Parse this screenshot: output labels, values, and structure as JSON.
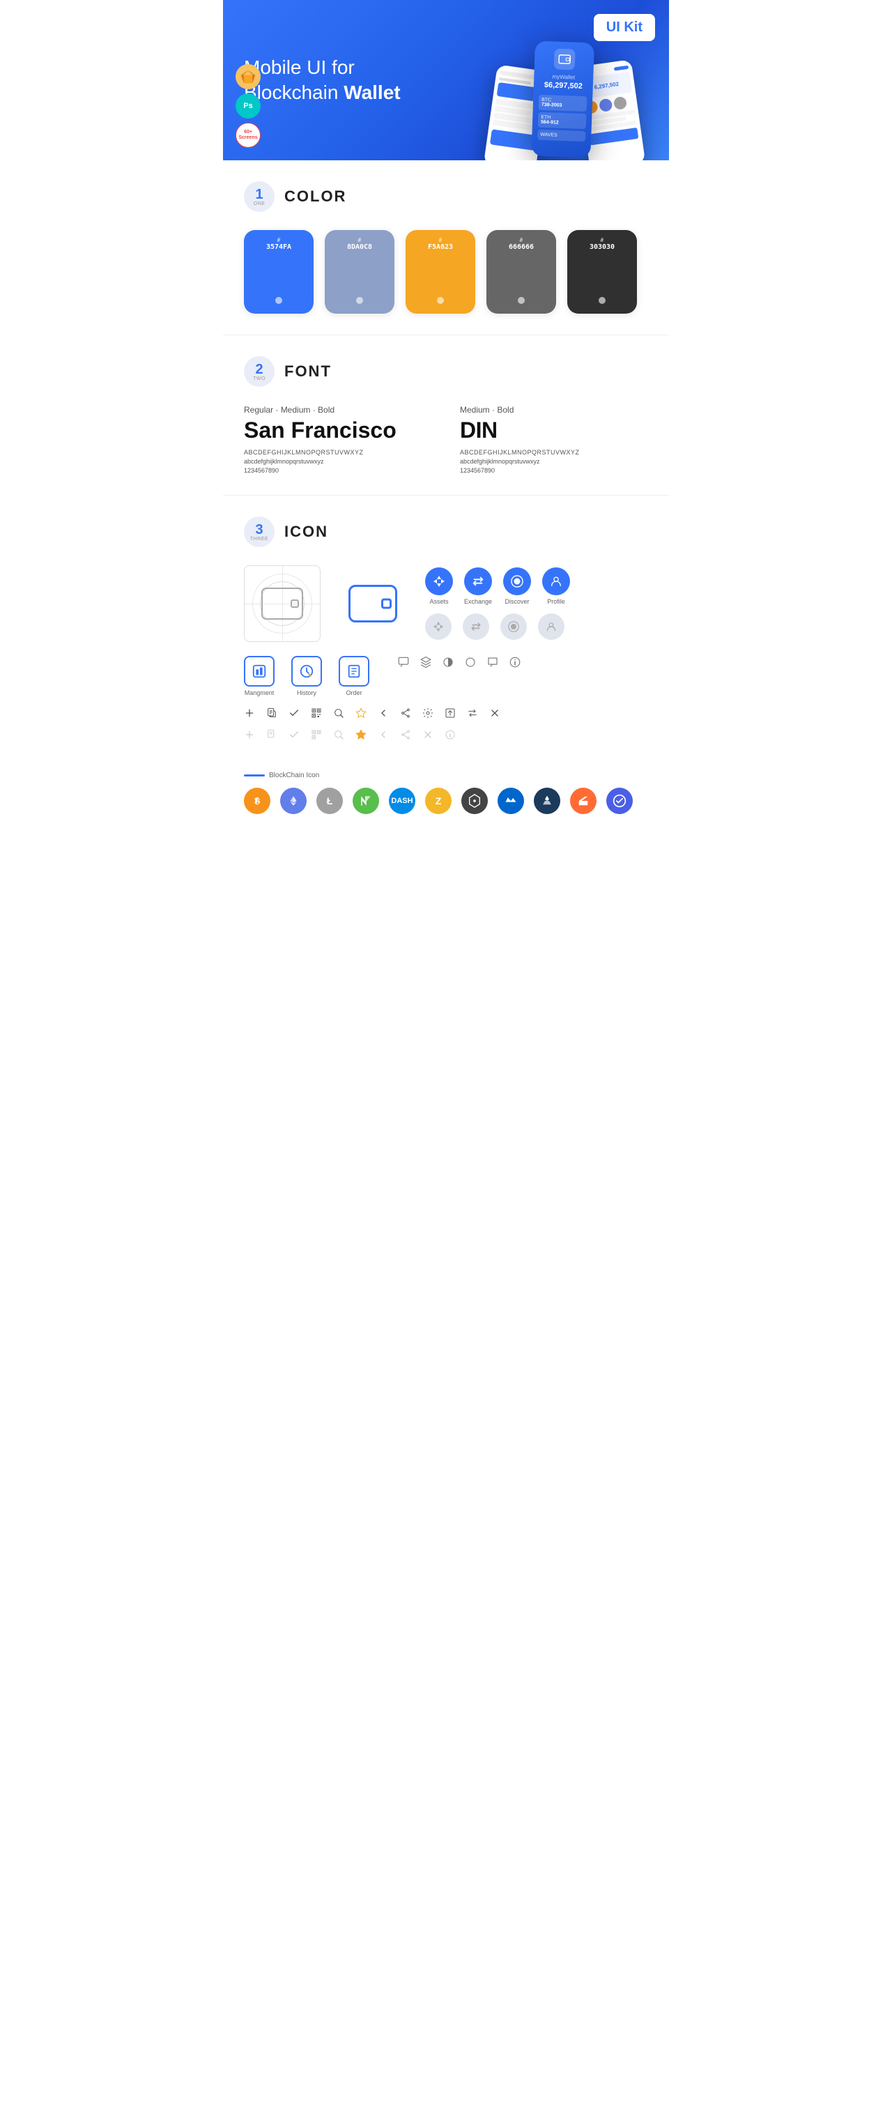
{
  "hero": {
    "title_normal": "Mobile UI for Blockchain",
    "title_bold": "Wallet",
    "badge": "UI Kit",
    "icons": [
      "Sketch",
      "Ps",
      "60+\nScreens"
    ]
  },
  "sections": {
    "color": {
      "number": "1",
      "sub": "ONE",
      "title": "COLOR",
      "swatches": [
        {
          "hex": "#3574FA",
          "label": "#",
          "value": "3574FA",
          "bg": "#3574FA"
        },
        {
          "hex": "#8DA0C8",
          "label": "#",
          "value": "8DA0C8",
          "bg": "#8DA0C8"
        },
        {
          "hex": "#F5A623",
          "label": "#",
          "value": "F5A623",
          "bg": "#F5A623"
        },
        {
          "hex": "#666666",
          "label": "#",
          "value": "666666",
          "bg": "#666666"
        },
        {
          "hex": "#303030",
          "label": "#",
          "value": "303030",
          "bg": "#303030"
        }
      ]
    },
    "font": {
      "number": "2",
      "sub": "TWO",
      "title": "FONT",
      "fonts": [
        {
          "style": "Regular · Medium · Bold",
          "name": "San Francisco",
          "uppercase": "ABCDEFGHIJKLMNOPQRSTUVWXYZ",
          "lowercase": "abcdefghijklmnopqrstuvwxyz",
          "numbers": "1234567890"
        },
        {
          "style": "Medium · Bold",
          "name": "DIN",
          "uppercase": "ABCDEFGHIJKLMNOPQRSTUVWXYZ",
          "lowercase": "abcdefghijklmnopqrstuvwxyz",
          "numbers": "1234567890"
        }
      ]
    },
    "icon": {
      "number": "3",
      "sub": "THREE",
      "title": "ICON",
      "nav_icons": [
        {
          "label": "Assets",
          "icon": "◆"
        },
        {
          "label": "Exchange",
          "icon": "⇌"
        },
        {
          "label": "Discover",
          "icon": "●"
        },
        {
          "label": "Profile",
          "icon": "⌂"
        }
      ],
      "bottom_icons": [
        {
          "label": "Mangment",
          "icon": "▦"
        },
        {
          "label": "History",
          "icon": "⏱"
        },
        {
          "label": "Order",
          "icon": "≡"
        }
      ],
      "blockchain_label": "BlockChain Icon",
      "crypto_coins": [
        "BTC",
        "ETH",
        "LTC",
        "NEO",
        "DASH",
        "ZEC",
        "IOTA",
        "WAVES",
        "KNC",
        "ZRX",
        "POLY"
      ]
    }
  }
}
